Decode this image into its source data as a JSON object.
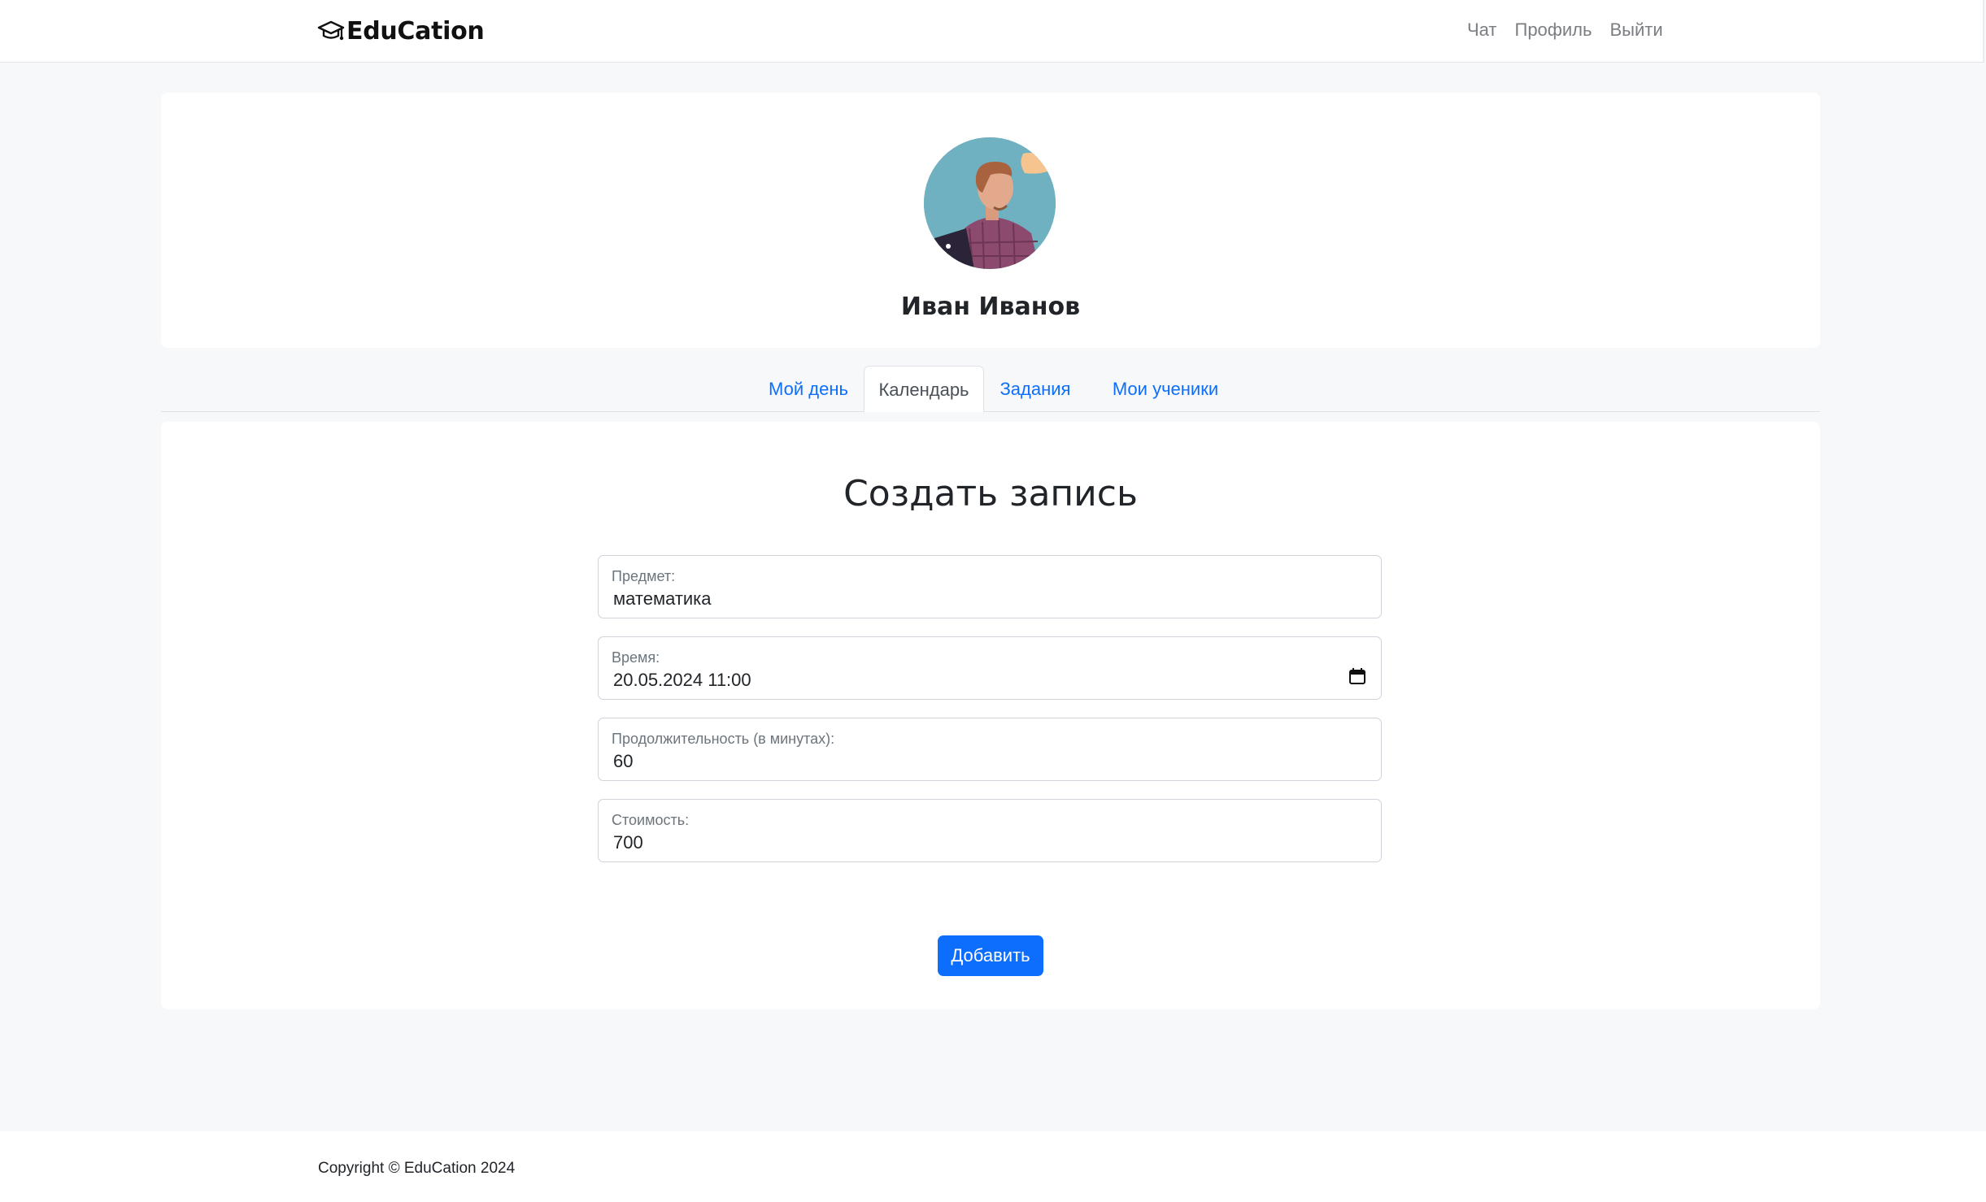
{
  "navbar": {
    "brand": "EduCation",
    "brand_icon": "graduation-cap-icon",
    "links": [
      "Чат",
      "Профиль",
      "Выйти"
    ]
  },
  "profile": {
    "name": "Иван Иванов",
    "avatar": "avatar-illustration"
  },
  "tabs": [
    {
      "label": "Мой день",
      "active": false
    },
    {
      "label": "Календарь",
      "active": true
    },
    {
      "label": "Задания",
      "active": false
    },
    {
      "label": "Мои ученики",
      "active": false
    }
  ],
  "form": {
    "title": "Создать запись",
    "fields": [
      {
        "label": "Предмет:",
        "value": "математика"
      },
      {
        "label": "Время:",
        "value": "20.05.2024 11:00",
        "icon": "calendar-icon"
      },
      {
        "label": "Продолжительность (в минутах):",
        "value": "60"
      },
      {
        "label": "Стоимость:",
        "value": "700"
      }
    ],
    "submit_label": "Добавить"
  },
  "footer": {
    "copyright": "Copyright © EduCation 2024"
  },
  "colors": {
    "primary": "#0d6efd",
    "background": "#f7f8fa",
    "nav_link": "#7a7e83"
  }
}
